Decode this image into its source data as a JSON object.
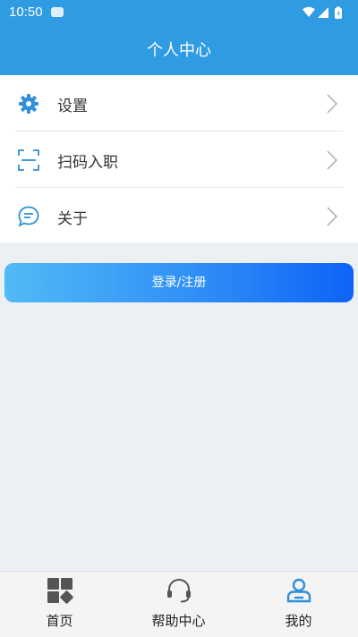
{
  "status_bar": {
    "time": "10:50"
  },
  "header": {
    "title": "个人中心"
  },
  "menu": {
    "items": [
      {
        "label": "设置",
        "icon": "gear-icon"
      },
      {
        "label": "扫码入职",
        "icon": "scan-icon"
      },
      {
        "label": "关于",
        "icon": "chat-bubble-icon"
      }
    ]
  },
  "login_button": {
    "label": "登录/注册"
  },
  "tabbar": {
    "tabs": [
      {
        "label": "首页",
        "icon": "home-grid-icon",
        "active": false
      },
      {
        "label": "帮助中心",
        "icon": "headset-icon",
        "active": false
      },
      {
        "label": "我的",
        "icon": "user-icon",
        "active": true
      }
    ]
  },
  "colors": {
    "header": "#2f9be2",
    "accent": "#2f9be2",
    "background": "#eceff4",
    "button_gradient_start": "#52baf6",
    "button_gradient_end": "#0d63f6"
  }
}
